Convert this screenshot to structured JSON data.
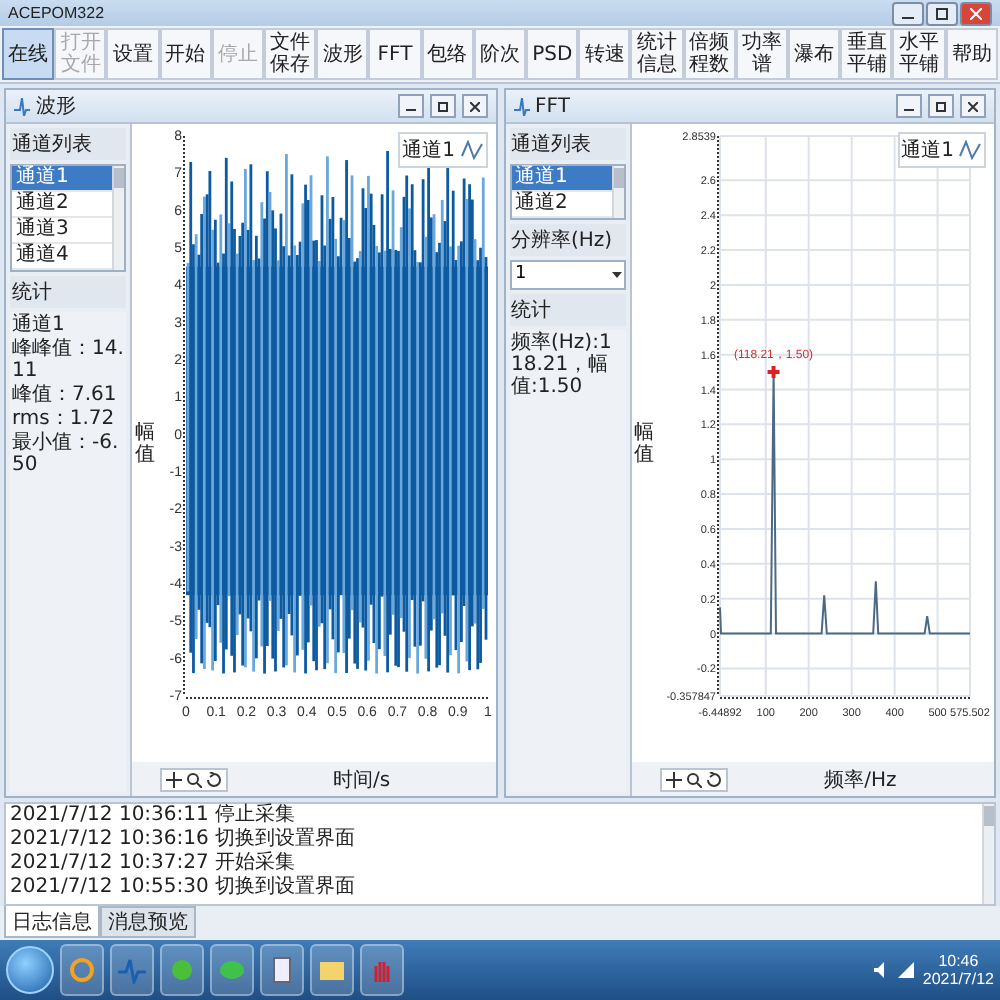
{
  "window": {
    "title": "ACEPOM322"
  },
  "toolbar": [
    {
      "label": "在线",
      "selected": true,
      "disabled": false
    },
    {
      "label": "打开文件",
      "selected": false,
      "disabled": true
    },
    {
      "label": "设置",
      "selected": false,
      "disabled": false
    },
    {
      "label": "开始",
      "selected": false,
      "disabled": false
    },
    {
      "label": "停止",
      "selected": false,
      "disabled": true
    },
    {
      "label": "文件保存",
      "selected": false,
      "disabled": false
    },
    {
      "label": "波形",
      "selected": false,
      "disabled": false
    },
    {
      "label": "FFT",
      "selected": false,
      "disabled": false
    },
    {
      "label": "包络",
      "selected": false,
      "disabled": false
    },
    {
      "label": "阶次",
      "selected": false,
      "disabled": false
    },
    {
      "label": "PSD",
      "selected": false,
      "disabled": false
    },
    {
      "label": "转速",
      "selected": false,
      "disabled": false
    },
    {
      "label": "统计信息",
      "selected": false,
      "disabled": false
    },
    {
      "label": "倍频程数",
      "selected": false,
      "disabled": false
    },
    {
      "label": "功率谱",
      "selected": false,
      "disabled": false
    },
    {
      "label": "瀑布",
      "selected": false,
      "disabled": false
    },
    {
      "label": "垂直平铺",
      "selected": false,
      "disabled": false
    },
    {
      "label": "水平平铺",
      "selected": false,
      "disabled": false
    },
    {
      "label": "帮助",
      "selected": false,
      "disabled": false
    }
  ],
  "panels": [
    {
      "kind": "waveform",
      "title": "波形",
      "channel_list": {
        "title": "通道列表",
        "items": [
          {
            "label": "通道1",
            "selected": true
          },
          {
            "label": "通道2",
            "selected": false
          },
          {
            "label": "通道3",
            "selected": false
          },
          {
            "label": "通道4",
            "selected": false
          }
        ]
      },
      "stats": {
        "title": "统计",
        "lines": [
          "通道1",
          "峰峰值：14.11",
          "峰值：7.61",
          "rms：1.72",
          "最小值：-6.50"
        ]
      },
      "chart": {
        "legend": "通道1",
        "ylabel": "幅值",
        "xlabel": "时间/s",
        "yticks": [
          "8",
          "7",
          "6",
          "5",
          "4",
          "3",
          "2",
          "1",
          "0",
          "-1",
          "-2",
          "-3",
          "-4",
          "-5",
          "-6",
          "-7"
        ],
        "xticks": [
          "0",
          "0.1",
          "0.2",
          "0.3",
          "0.4",
          "0.5",
          "0.6",
          "0.7",
          "0.8",
          "0.9",
          "1"
        ]
      }
    },
    {
      "kind": "fft",
      "title": "FFT",
      "channel_list": {
        "title": "通道列表",
        "items": [
          {
            "label": "通道1",
            "selected": true
          },
          {
            "label": "通道2",
            "selected": false
          }
        ]
      },
      "resolution": {
        "label": "分辨率(Hz)",
        "value": "1"
      },
      "stats": {
        "title": "统计",
        "lines": [
          "频率(Hz):118.21，幅值:1.50"
        ]
      },
      "chart": {
        "chart_data": {
          "type": "line",
          "grid": true,
          "xlabel": "频率/Hz",
          "ylabel": "幅值",
          "x": [
            -6.44892,
            -4,
            0,
            112,
            118.21,
            124,
            230,
            236,
            242,
            350,
            356,
            362,
            470,
            476,
            482,
            575.502
          ],
          "series": [
            {
              "name": "通道1",
              "color": "#4a6a84",
              "values": [
                0.15,
                0,
                0,
                0,
                1.5,
                0,
                0,
                0.22,
                0,
                0,
                0.3,
                0,
                0,
                0.1,
                0,
                0
              ]
            }
          ],
          "xlim": [
            -6.44892,
            575.502
          ],
          "ylim": [
            -0.357847,
            2.8539
          ],
          "xticks": [
            {
              "value": -6.44892,
              "label": "-6.44892"
            },
            100,
            200,
            300,
            400,
            500,
            {
              "value": 575.502,
              "label": "575.502"
            }
          ],
          "yticks": [
            {
              "value": -0.357847,
              "label": "-0.357847"
            },
            -0.2,
            0,
            0.2,
            0.4,
            0.6,
            0.8,
            1,
            1.2,
            1.4,
            1.6,
            1.8,
            2,
            2.2,
            2.4,
            2.6,
            {
              "value": 2.8539,
              "label": "2.8539"
            }
          ],
          "annotations": [
            {
              "x": 118.21,
              "y": 1.5,
              "text": "(118.21，1.50)"
            }
          ]
        }
      }
    }
  ],
  "log": {
    "lines": [
      "2021/7/12 10:36:11 停止采集",
      "2021/7/12 10:36:16 切换到设置界面",
      "2021/7/12 10:37:27 开始采集",
      "2021/7/12 10:55:30 切换到设置界面"
    ],
    "tabs": [
      {
        "label": "日志信息",
        "selected": true
      },
      {
        "label": "消息预览",
        "selected": false
      }
    ]
  },
  "taskbar": {
    "time": "10:46",
    "date": "2021/7/12"
  }
}
